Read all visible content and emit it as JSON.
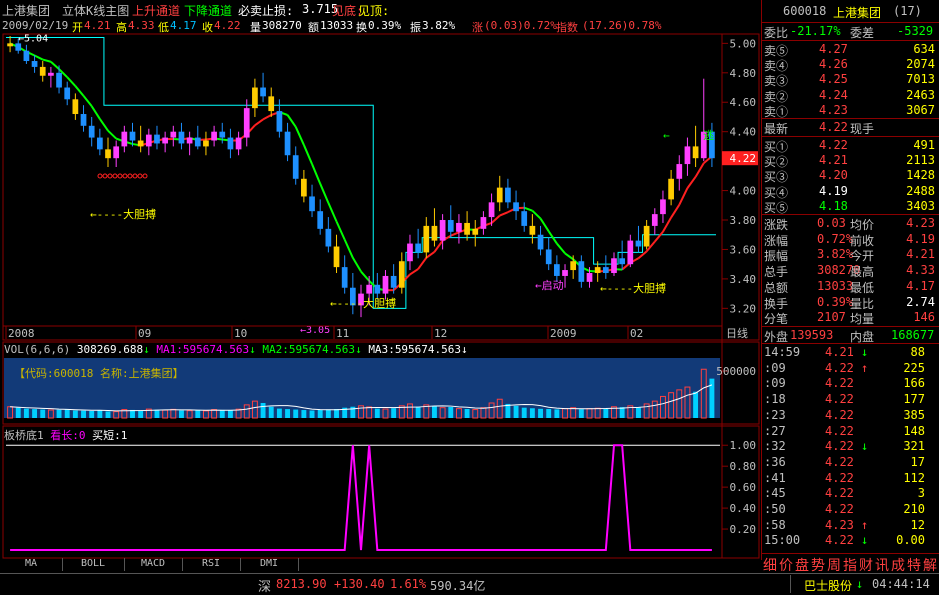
{
  "colors": {
    "up": "#ff4040",
    "down": "#00c0ff",
    "yellow": "#ffff00",
    "white": "#ffffff",
    "green": "#00ff00",
    "magenta": "#ff00ff",
    "cyan": "#00ffff",
    "gray": "#c0c0c0",
    "border": "#8b0000"
  },
  "header": {
    "stock_name": "上港集团",
    "chart_name": "立体K线主图",
    "up_channel": "上升通道",
    "down_channel": "下降通道",
    "stop_loss_label": "必卖止损:",
    "stop_loss_value": "3.715",
    "bottom_label": "见底:",
    "top_label": "见顶:"
  },
  "info": {
    "date": "2009/02/19",
    "open_label": "开",
    "open": "4.21",
    "high_label": "高",
    "high": "4.33",
    "low_label": "低",
    "low": "4.17",
    "close_label": "收",
    "close": "4.22",
    "vol_label": "量",
    "vol": "308270",
    "amt_label": "额",
    "amt": "13033",
    "turn_label": "换",
    "turn": "0.39%",
    "amp_label": "振",
    "amp": "3.82%",
    "chg_label": "涨",
    "chg": "(0.03)0.72%",
    "idx_label": "指数",
    "idx": "(17.26)0.78%"
  },
  "chart_data": [
    {
      "type": "candlestick",
      "title": "立体K线主图",
      "y_ticks": [
        "5.00",
        "4.80",
        "4.60",
        "4.40",
        "4.20",
        "4.00",
        "3.80",
        "3.60",
        "3.40",
        "3.20"
      ],
      "ylim": [
        3.08,
        5.05
      ],
      "x_labels": [
        "2008",
        "09",
        "10",
        "11",
        "12",
        "2009",
        "02"
      ],
      "x_axis_name": "日线",
      "current_price_tag": "4.22",
      "max_label": "5.04",
      "min_label": "3.05",
      "annotations": [
        "大胆搏",
        "大胆搏",
        "大胆搏",
        "启动",
        "逃"
      ],
      "stop_line_value": 3.715,
      "ohlc": [
        [
          4.98,
          5.05,
          4.94,
          5.0
        ],
        [
          5.0,
          5.03,
          4.93,
          4.95
        ],
        [
          4.95,
          4.99,
          4.86,
          4.88
        ],
        [
          4.88,
          4.92,
          4.8,
          4.84
        ],
        [
          4.84,
          4.88,
          4.74,
          4.78
        ],
        [
          4.78,
          4.84,
          4.7,
          4.8
        ],
        [
          4.8,
          4.85,
          4.66,
          4.7
        ],
        [
          4.7,
          4.74,
          4.58,
          4.62
        ],
        [
          4.62,
          4.66,
          4.48,
          4.52
        ],
        [
          4.52,
          4.58,
          4.4,
          4.44
        ],
        [
          4.44,
          4.5,
          4.3,
          4.36
        ],
        [
          4.36,
          4.42,
          4.24,
          4.28
        ],
        [
          4.28,
          4.36,
          4.16,
          4.22
        ],
        [
          4.22,
          4.34,
          4.16,
          4.3
        ],
        [
          4.3,
          4.44,
          4.26,
          4.4
        ],
        [
          4.4,
          4.46,
          4.3,
          4.34
        ],
        [
          4.34,
          4.44,
          4.26,
          4.3
        ],
        [
          4.3,
          4.42,
          4.24,
          4.38
        ],
        [
          4.38,
          4.44,
          4.28,
          4.32
        ],
        [
          4.32,
          4.4,
          4.26,
          4.36
        ],
        [
          4.36,
          4.44,
          4.3,
          4.4
        ],
        [
          4.4,
          4.46,
          4.28,
          4.32
        ],
        [
          4.32,
          4.4,
          4.24,
          4.36
        ],
        [
          4.36,
          4.44,
          4.28,
          4.3
        ],
        [
          4.3,
          4.4,
          4.24,
          4.34
        ],
        [
          4.34,
          4.44,
          4.3,
          4.4
        ],
        [
          4.4,
          4.46,
          4.32,
          4.36
        ],
        [
          4.36,
          4.42,
          4.22,
          4.28
        ],
        [
          4.28,
          4.4,
          4.24,
          4.36
        ],
        [
          4.36,
          4.62,
          4.3,
          4.56
        ],
        [
          4.56,
          4.76,
          4.5,
          4.7
        ],
        [
          4.7,
          4.8,
          4.6,
          4.64
        ],
        [
          4.64,
          4.7,
          4.5,
          4.54
        ],
        [
          4.54,
          4.62,
          4.36,
          4.4
        ],
        [
          4.4,
          4.46,
          4.2,
          4.24
        ],
        [
          4.24,
          4.3,
          4.04,
          4.08
        ],
        [
          4.08,
          4.14,
          3.92,
          3.96
        ],
        [
          3.96,
          4.04,
          3.82,
          3.86
        ],
        [
          3.86,
          3.94,
          3.7,
          3.74
        ],
        [
          3.74,
          3.82,
          3.58,
          3.62
        ],
        [
          3.62,
          3.7,
          3.44,
          3.48
        ],
        [
          3.48,
          3.56,
          3.3,
          3.34
        ],
        [
          3.34,
          3.44,
          3.16,
          3.22
        ],
        [
          3.22,
          3.36,
          3.14,
          3.3
        ],
        [
          3.3,
          3.42,
          3.22,
          3.36
        ],
        [
          3.36,
          3.44,
          3.26,
          3.3
        ],
        [
          3.3,
          3.46,
          3.26,
          3.42
        ],
        [
          3.42,
          3.5,
          3.3,
          3.34
        ],
        [
          3.34,
          3.58,
          3.3,
          3.52
        ],
        [
          3.52,
          3.7,
          3.46,
          3.64
        ],
        [
          3.64,
          3.74,
          3.54,
          3.58
        ],
        [
          3.58,
          3.82,
          3.54,
          3.76
        ],
        [
          3.76,
          3.88,
          3.62,
          3.66
        ],
        [
          3.66,
          3.84,
          3.6,
          3.8
        ],
        [
          3.8,
          3.9,
          3.68,
          3.72
        ],
        [
          3.72,
          3.84,
          3.64,
          3.78
        ],
        [
          3.78,
          3.86,
          3.66,
          3.7
        ],
        [
          3.7,
          3.8,
          3.62,
          3.74
        ],
        [
          3.74,
          3.86,
          3.7,
          3.82
        ],
        [
          3.82,
          3.98,
          3.76,
          3.92
        ],
        [
          3.92,
          4.1,
          3.86,
          4.02
        ],
        [
          4.02,
          4.08,
          3.88,
          3.92
        ],
        [
          3.92,
          4.0,
          3.8,
          3.86
        ],
        [
          3.86,
          3.92,
          3.72,
          3.76
        ],
        [
          3.76,
          3.84,
          3.64,
          3.7
        ],
        [
          3.7,
          3.76,
          3.56,
          3.6
        ],
        [
          3.6,
          3.68,
          3.46,
          3.5
        ],
        [
          3.5,
          3.56,
          3.38,
          3.42
        ],
        [
          3.42,
          3.5,
          3.34,
          3.46
        ],
        [
          3.46,
          3.56,
          3.4,
          3.52
        ],
        [
          3.52,
          3.56,
          3.34,
          3.38
        ],
        [
          3.38,
          3.48,
          3.34,
          3.44
        ],
        [
          3.44,
          3.52,
          3.38,
          3.48
        ],
        [
          3.48,
          3.56,
          3.4,
          3.44
        ],
        [
          3.44,
          3.58,
          3.42,
          3.54
        ],
        [
          3.54,
          3.66,
          3.46,
          3.5
        ],
        [
          3.5,
          3.7,
          3.48,
          3.66
        ],
        [
          3.66,
          3.76,
          3.58,
          3.62
        ],
        [
          3.62,
          3.8,
          3.6,
          3.76
        ],
        [
          3.76,
          3.88,
          3.7,
          3.84
        ],
        [
          3.84,
          4.0,
          3.78,
          3.94
        ],
        [
          3.94,
          4.14,
          3.9,
          4.08
        ],
        [
          4.08,
          4.24,
          4.0,
          4.18
        ],
        [
          4.18,
          4.36,
          4.1,
          4.3
        ],
        [
          4.3,
          4.44,
          4.16,
          4.22
        ],
        [
          4.22,
          4.76,
          4.2,
          4.4
        ],
        [
          4.4,
          4.46,
          4.16,
          4.22
        ]
      ]
    },
    {
      "type": "bar",
      "title": "VOL(6,6,6)",
      "series": [
        {
          "name": "VOL",
          "value": "308269.688"
        },
        {
          "name": "MA1",
          "value": "595674.563"
        },
        {
          "name": "MA2",
          "value": "595674.563"
        },
        {
          "name": "MA3",
          "value": "595674.563"
        }
      ],
      "code_label": "【代码:600018 名称:上港集团】",
      "y_tick": "500000",
      "volumes": [
        120,
        110,
        100,
        95,
        90,
        85,
        88,
        92,
        80,
        78,
        75,
        82,
        70,
        68,
        90,
        86,
        80,
        95,
        88,
        84,
        92,
        80,
        78,
        84,
        76,
        90,
        86,
        80,
        94,
        140,
        180,
        160,
        120,
        100,
        95,
        90,
        85,
        80,
        88,
        92,
        96,
        110,
        120,
        130,
        118,
        100,
        96,
        104,
        130,
        150,
        120,
        140,
        126,
        110,
        118,
        100,
        96,
        90,
        110,
        160,
        200,
        150,
        130,
        110,
        104,
        98,
        96,
        92,
        100,
        110,
        94,
        100,
        104,
        98,
        120,
        116,
        130,
        110,
        150,
        180,
        230,
        270,
        300,
        330,
        280,
        520,
        420
      ],
      "ylim": [
        0,
        640
      ]
    },
    {
      "type": "line",
      "title": "板桥底1",
      "series_labels": [
        "看长:0",
        "买短:1"
      ],
      "y_ticks": [
        "1.00",
        "0.80",
        "0.60",
        "0.40",
        "0.20"
      ],
      "ylim": [
        0,
        1.05
      ],
      "values": [
        0,
        0,
        0,
        0,
        0,
        0,
        0,
        0,
        0,
        0,
        0,
        0,
        0,
        0,
        0,
        0,
        0,
        0,
        0,
        0,
        0,
        0,
        0,
        0,
        0,
        0,
        0,
        0,
        0,
        0,
        0,
        0,
        0,
        0,
        0,
        0,
        0,
        0,
        0,
        0,
        0,
        0,
        1,
        0,
        1,
        0,
        0,
        0,
        0,
        0,
        0,
        0,
        0,
        0,
        0,
        0,
        0,
        0,
        0,
        0,
        0,
        0,
        0,
        0,
        0,
        0,
        0,
        0,
        0,
        0,
        0,
        0,
        0,
        0,
        1,
        1,
        0,
        0,
        0,
        0,
        0,
        0,
        0,
        0,
        0,
        0,
        0
      ]
    }
  ],
  "right_panel": {
    "code": "600018",
    "name": "上港集团",
    "count": "(17)",
    "wei_bi_label": "委比",
    "wei_bi": "-21.17%",
    "wei_cha_label": "委差",
    "wei_cha": "-5329",
    "sells": [
      {
        "label": "卖⑤",
        "price": "4.27",
        "vol": "634"
      },
      {
        "label": "卖④",
        "price": "4.26",
        "vol": "2074"
      },
      {
        "label": "卖③",
        "price": "4.25",
        "vol": "7013"
      },
      {
        "label": "卖②",
        "price": "4.24",
        "vol": "2463"
      },
      {
        "label": "卖①",
        "price": "4.23",
        "vol": "3067"
      }
    ],
    "last_label": "最新",
    "last": "4.22",
    "hand_label": "现手",
    "buys": [
      {
        "label": "买①",
        "price": "4.22",
        "vol": "491"
      },
      {
        "label": "买②",
        "price": "4.21",
        "vol": "2113"
      },
      {
        "label": "买③",
        "price": "4.20",
        "vol": "1428"
      },
      {
        "label": "买④",
        "price": "4.19",
        "vol": "2488"
      },
      {
        "label": "买⑤",
        "price": "4.18",
        "vol": "3403"
      }
    ],
    "stats": [
      {
        "l1": "涨跌",
        "v1": "0.03",
        "l2": "均价",
        "v2": "4.23"
      },
      {
        "l1": "涨幅",
        "v1": "0.72%",
        "l2": "前收",
        "v2": "4.19"
      },
      {
        "l1": "振幅",
        "v1": "3.82%",
        "l2": "今开",
        "v2": "4.21"
      },
      {
        "l1": "总手",
        "v1": "308270",
        "l2": "最高",
        "v2": "4.33"
      },
      {
        "l1": "总额",
        "v1": "13033",
        "l2": "最低",
        "v2": "4.17"
      },
      {
        "l1": "换手",
        "v1": "0.39%",
        "l2": "量比",
        "v2": "2.74"
      },
      {
        "l1": "分笔",
        "v1": "2107",
        "l2": "均量",
        "v2": "146"
      }
    ],
    "outer_label": "外盘",
    "outer": "139593",
    "inner_label": "内盘",
    "inner": "168677",
    "ticks": [
      {
        "t": "14:59",
        "p": "4.21",
        "d": "↓",
        "v": "88"
      },
      {
        "t": ":09",
        "p": "4.22",
        "d": "↑",
        "v": "225"
      },
      {
        "t": ":09",
        "p": "4.22",
        "d": "",
        "v": "166"
      },
      {
        "t": ":18",
        "p": "4.22",
        "d": "",
        "v": "177"
      },
      {
        "t": ":23",
        "p": "4.22",
        "d": "",
        "v": "385"
      },
      {
        "t": ":27",
        "p": "4.22",
        "d": "",
        "v": "148"
      },
      {
        "t": ":32",
        "p": "4.22",
        "d": "↓",
        "v": "321"
      },
      {
        "t": ":36",
        "p": "4.22",
        "d": "",
        "v": "17"
      },
      {
        "t": ":41",
        "p": "4.22",
        "d": "",
        "v": "112"
      },
      {
        "t": ":45",
        "p": "4.22",
        "d": "",
        "v": "3"
      },
      {
        "t": ":50",
        "p": "4.22",
        "d": "",
        "v": "210"
      },
      {
        "t": ":58",
        "p": "4.23",
        "d": "↑",
        "v": "12"
      },
      {
        "t": "15:00",
        "p": "4.22",
        "d": "↓",
        "v": "0.00"
      }
    ],
    "footer_tabs": [
      "细",
      "价",
      "盘",
      "势",
      "周",
      "指",
      "财",
      "讯",
      "成",
      "特",
      "解"
    ]
  },
  "bottom_tabs": [
    "MA",
    "BOLL",
    "MACD",
    "RSI",
    "DMI"
  ],
  "status": {
    "market": "深",
    "index": "8213.90",
    "change": "+130.40",
    "pct": "1.61%",
    "amount": "590.34亿",
    "stock": "巴士股份",
    "arrow": "↓",
    "time": "04:44:14"
  }
}
